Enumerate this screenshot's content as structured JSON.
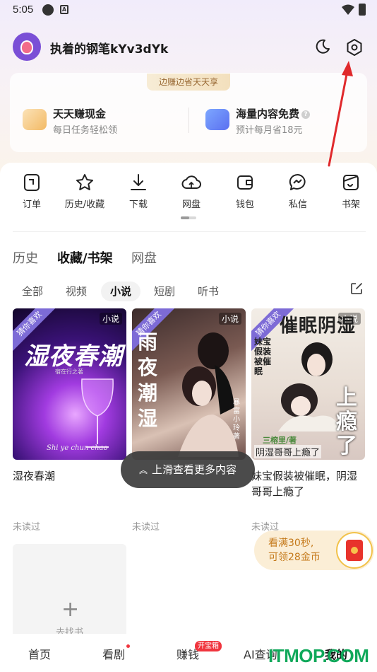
{
  "status_bar": {
    "time": "5:05"
  },
  "header": {
    "username": "执着的钢笔kYv3dYk",
    "night_mode_icon": "moon-icon",
    "settings_icon": "settings-icon"
  },
  "vip": {
    "banner": "边赚边省天天享",
    "perks": [
      {
        "title": "天天赚现金",
        "subtitle": "每日任务轻松领"
      },
      {
        "title": "海量内容免费",
        "subtitle": "预计每月省18元"
      }
    ]
  },
  "quick_actions": [
    {
      "label": "订单",
      "icon": "order-icon"
    },
    {
      "label": "历史/收藏",
      "icon": "star-icon"
    },
    {
      "label": "下载",
      "icon": "download-icon"
    },
    {
      "label": "网盘",
      "icon": "cloud-icon"
    },
    {
      "label": "钱包",
      "icon": "wallet-icon"
    },
    {
      "label": "私信",
      "icon": "message-icon"
    },
    {
      "label": "书架",
      "icon": "bookshelf-icon"
    }
  ],
  "main_tabs": [
    {
      "label": "历史"
    },
    {
      "label": "收藏/书架",
      "active": true
    },
    {
      "label": "网盘"
    }
  ],
  "filters": [
    {
      "label": "全部"
    },
    {
      "label": "视频"
    },
    {
      "label": "小说",
      "active": true
    },
    {
      "label": "短剧"
    },
    {
      "label": "听书"
    }
  ],
  "books": [
    {
      "title": "湿夜春潮",
      "type_badge": "小说",
      "ribbon": "猜你喜欢",
      "cover_text": "湿夜春潮",
      "cover_author": "宿在行之著",
      "cover_pinyin": "Shi ye chun chao",
      "status": "未读过"
    },
    {
      "title": "",
      "type_badge": "小说",
      "ribbon": "猜你喜欢",
      "cover_text": "雨夜潮湿",
      "cover_author": "暴富小玲 著",
      "status": "未读过"
    },
    {
      "title": "妹宝假装被催眠，阴湿哥哥上瘾了",
      "type_badge": "小说",
      "ribbon": "猜你喜欢",
      "cover_text": "催眠阴湿",
      "cover_sub": "妹宝假装被催眠",
      "cover_big": "上瘾了",
      "cover_author": "三榕里/著",
      "cover_tagline": "阴湿哥哥上瘾了",
      "status": "未读过"
    }
  ],
  "add_book": {
    "label": "去找书"
  },
  "toast": {
    "text": "上滑查看更多内容"
  },
  "reward": {
    "line1": "看满30秒,",
    "line2": "可领28金币"
  },
  "bottom_nav": [
    {
      "label": "首页"
    },
    {
      "label": "看剧"
    },
    {
      "label": "赚钱",
      "badge": "开宝箱"
    },
    {
      "label": "AI查询"
    },
    {
      "label": "我的"
    }
  ],
  "watermark": "ITMOP.COM",
  "colors": {
    "accent": "#7d6bd6",
    "badge_red": "#f0353e",
    "reward_orange": "#c47818",
    "annotation_arrow": "#e0292c"
  }
}
